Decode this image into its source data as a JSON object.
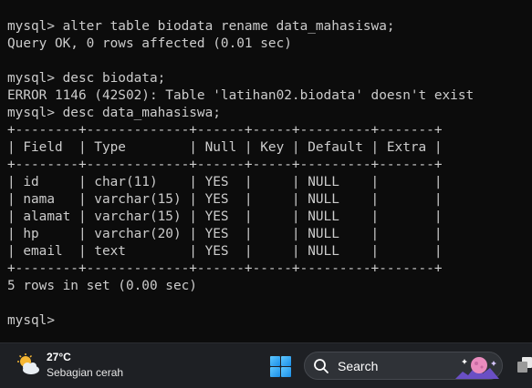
{
  "terminal": {
    "lines": [
      "mysql> alter table biodata rename data_mahasiswa;",
      "Query OK, 0 rows affected (0.01 sec)",
      "",
      "mysql> desc biodata;",
      "ERROR 1146 (42S02): Table 'latihan02.biodata' doesn't exist",
      "mysql> desc data_mahasiswa;",
      "+--------+-------------+------+-----+---------+-------+",
      "| Field  | Type        | Null | Key | Default | Extra |",
      "+--------+-------------+------+-----+---------+-------+",
      "| id     | char(11)    | YES  |     | NULL    |       |",
      "| nama   | varchar(15) | YES  |     | NULL    |       |",
      "| alamat | varchar(15) | YES  |     | NULL    |       |",
      "| hp     | varchar(20) | YES  |     | NULL    |       |",
      "| email  | text        | YES  |     | NULL    |       |",
      "+--------+-------------+------+-----+---------+-------+",
      "5 rows in set (0.00 sec)",
      "",
      "mysql> "
    ]
  },
  "taskbar": {
    "weather_temp": "27°C",
    "weather_desc": "Sebagian cerah",
    "search_label": "Search"
  },
  "icons": {
    "weather": "partly-sunny-icon",
    "start": "windows-logo-icon",
    "search": "search-icon",
    "tray": "tray-window-icon"
  },
  "colors": {
    "terminal_bg": "#0c0c0c",
    "terminal_text": "#cccccc",
    "taskbar_bg": "#1e2024",
    "start_blue": "#1a8ee8"
  }
}
